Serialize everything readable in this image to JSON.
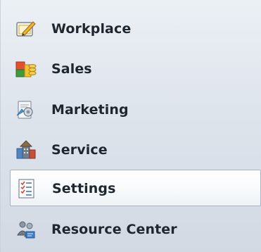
{
  "nav": {
    "items": [
      {
        "label": "Workplace",
        "icon": "workplace-icon",
        "selected": false
      },
      {
        "label": "Sales",
        "icon": "sales-icon",
        "selected": false
      },
      {
        "label": "Marketing",
        "icon": "marketing-icon",
        "selected": false
      },
      {
        "label": "Service",
        "icon": "service-icon",
        "selected": false
      },
      {
        "label": "Settings",
        "icon": "settings-icon",
        "selected": true
      },
      {
        "label": "Resource Center",
        "icon": "resource-center-icon",
        "selected": false
      }
    ]
  },
  "colors": {
    "pane_background": "#dfe5ed",
    "selected_background": "#ffffff",
    "selected_border": "#a9b3c1",
    "label_text": "#1e2630"
  }
}
